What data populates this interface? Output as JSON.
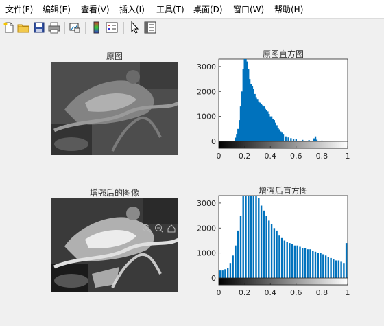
{
  "menubar": {
    "items": [
      {
        "id": "file",
        "label": "文件(F)"
      },
      {
        "id": "edit",
        "label": "编辑(E)"
      },
      {
        "id": "view",
        "label": "查看(V)"
      },
      {
        "id": "insert",
        "label": "插入(I)"
      },
      {
        "id": "tools",
        "label": "工具(T)"
      },
      {
        "id": "desktop",
        "label": "桌面(D)"
      },
      {
        "id": "window",
        "label": "窗口(W)"
      },
      {
        "id": "help",
        "label": "帮助(H)"
      }
    ]
  },
  "toolbar": {
    "buttons": [
      "new-figure-icon",
      "open-file-icon",
      "save-icon",
      "print-icon",
      "link-plot-icon",
      "insert-colorbar-icon",
      "insert-legend-icon",
      "edit-plot-icon",
      "property-inspector-icon"
    ]
  },
  "figure": {
    "original_title": "原图",
    "enhanced_title": "增强后的图像",
    "hist1": {
      "title": "原图直方图",
      "yticks": [
        "0",
        "1000",
        "2000",
        "3000"
      ],
      "xticks": [
        "0",
        "0.2",
        "0.4",
        "0.6",
        "0.8",
        "1"
      ]
    },
    "hist2": {
      "title": "增强后直方图",
      "yticks": [
        "0",
        "1000",
        "2000",
        "3000"
      ],
      "xticks": [
        "0",
        "0.2",
        "0.4",
        "0.6",
        "0.8",
        "1"
      ]
    },
    "colors": {
      "bar": "#0072bd",
      "axes_bg": "#ffffff"
    }
  },
  "chart_data": [
    {
      "type": "bar",
      "title": "原图直方图",
      "xlim": [
        0,
        1
      ],
      "ylim": [
        0,
        3300
      ],
      "x": [
        0.13,
        0.14,
        0.15,
        0.16,
        0.17,
        0.18,
        0.19,
        0.2,
        0.21,
        0.22,
        0.23,
        0.24,
        0.25,
        0.26,
        0.27,
        0.28,
        0.29,
        0.3,
        0.31,
        0.32,
        0.33,
        0.34,
        0.35,
        0.36,
        0.37,
        0.38,
        0.39,
        0.4,
        0.41,
        0.42,
        0.43,
        0.44,
        0.45,
        0.46,
        0.47,
        0.48,
        0.49,
        0.5,
        0.52,
        0.54,
        0.56,
        0.58,
        0.6,
        0.65,
        0.7,
        0.74,
        0.75,
        0.76,
        0.8,
        0.85,
        0.9,
        0.95
      ],
      "values": [
        150,
        300,
        500,
        850,
        1400,
        2000,
        2900,
        3300,
        3300,
        3200,
        2900,
        2500,
        2300,
        2200,
        2100,
        1900,
        1750,
        1700,
        1600,
        1550,
        1500,
        1450,
        1400,
        1300,
        1250,
        1200,
        1100,
        1000,
        1000,
        900,
        850,
        750,
        650,
        550,
        480,
        400,
        350,
        300,
        200,
        160,
        130,
        110,
        90,
        60,
        50,
        120,
        200,
        70,
        30,
        20,
        15,
        10
      ]
    },
    {
      "type": "bar",
      "title": "增强后直方图",
      "xlim": [
        0,
        1
      ],
      "ylim": [
        0,
        3300
      ],
      "x": [
        0.01,
        0.03,
        0.05,
        0.07,
        0.09,
        0.11,
        0.13,
        0.15,
        0.17,
        0.19,
        0.21,
        0.23,
        0.25,
        0.27,
        0.29,
        0.31,
        0.33,
        0.35,
        0.37,
        0.39,
        0.41,
        0.43,
        0.45,
        0.47,
        0.49,
        0.51,
        0.53,
        0.55,
        0.57,
        0.59,
        0.61,
        0.63,
        0.65,
        0.67,
        0.69,
        0.71,
        0.73,
        0.75,
        0.77,
        0.79,
        0.81,
        0.83,
        0.85,
        0.87,
        0.89,
        0.91,
        0.93,
        0.95,
        0.97,
        0.99
      ],
      "values": [
        300,
        300,
        350,
        400,
        600,
        900,
        1300,
        1900,
        2500,
        3300,
        3300,
        3300,
        3300,
        3300,
        3300,
        3200,
        2900,
        2700,
        2500,
        2300,
        2150,
        2000,
        1900,
        1700,
        1600,
        1500,
        1450,
        1400,
        1350,
        1300,
        1300,
        1250,
        1200,
        1200,
        1150,
        1150,
        1100,
        1050,
        1000,
        1000,
        950,
        900,
        850,
        800,
        750,
        700,
        700,
        650,
        600,
        1400
      ]
    }
  ]
}
